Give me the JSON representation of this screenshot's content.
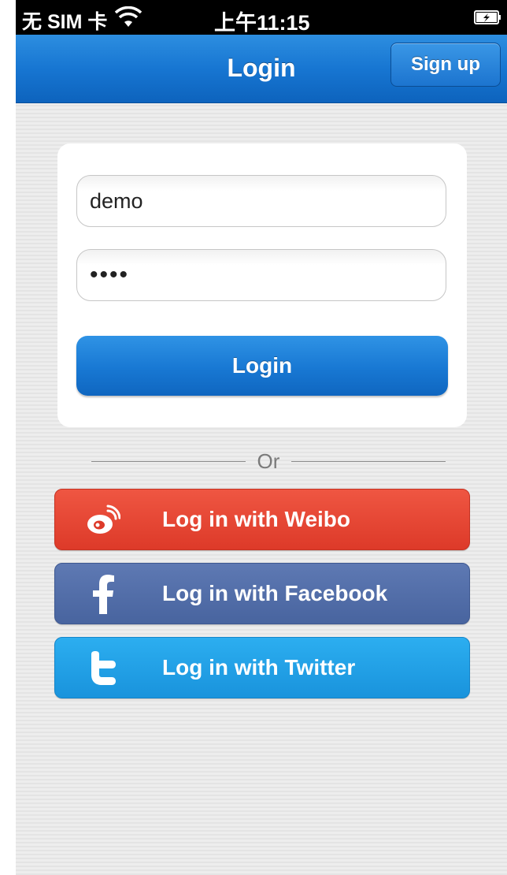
{
  "status_bar": {
    "carrier": "无 SIM 卡",
    "time": "上午11:15"
  },
  "nav": {
    "title": "Login",
    "signup_label": "Sign up"
  },
  "form": {
    "username_value": "demo",
    "password_value": "••••",
    "login_label": "Login"
  },
  "divider": {
    "text": "Or"
  },
  "social": [
    {
      "label": "Log in with Weibo",
      "icon": "weibo-icon",
      "color": "#e8473a"
    },
    {
      "label": "Log in with Facebook",
      "icon": "facebook-icon",
      "color": "#526ea9"
    },
    {
      "label": "Log in with Twitter",
      "icon": "twitter-icon",
      "color": "#22a3e8"
    }
  ],
  "colors": {
    "nav_blue": "#1776d2",
    "background": "#ececec"
  }
}
